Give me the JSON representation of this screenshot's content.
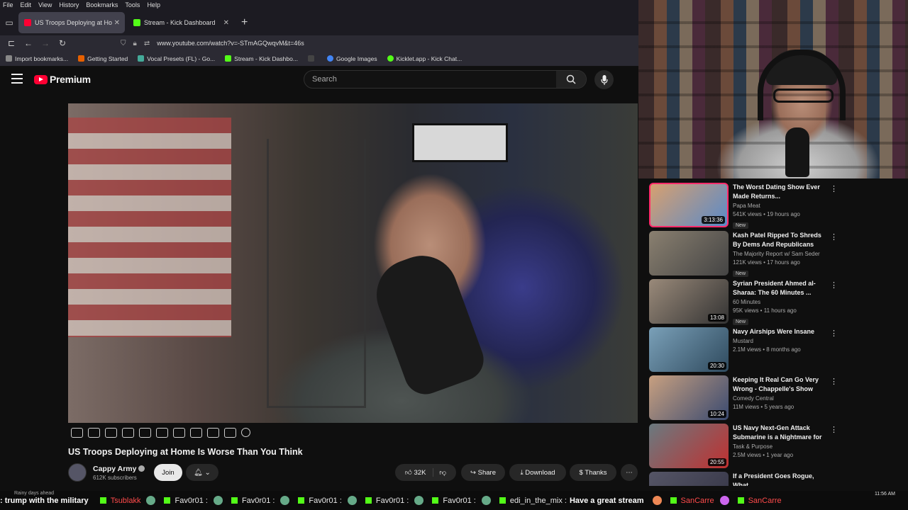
{
  "browser": {
    "menu": [
      "File",
      "Edit",
      "View",
      "History",
      "Bookmarks",
      "Tools",
      "Help"
    ],
    "tabs": [
      {
        "label": "US Troops Deploying at Ho",
        "active": true,
        "fav_color": "#ff0033"
      },
      {
        "label": "Stream - Kick Dashboard",
        "active": false,
        "fav_color": "#53fc18"
      }
    ],
    "url": "www.youtube.com/watch?v=-STmAGQwqvM&t=46s",
    "bookmarks": [
      {
        "label": "Import bookmarks...",
        "color": "#888"
      },
      {
        "label": "Getting Started",
        "color": "#e66000"
      },
      {
        "label": "Vocal Presets (FL) - Go...",
        "color": "#4a9"
      },
      {
        "label": "Stream - Kick Dashbo...",
        "color": "#53fc18"
      },
      {
        "label": "",
        "color": "#444"
      },
      {
        "label": "Google Images",
        "color": "#4285f4"
      },
      {
        "label": "Kicklet.app - Kick Chat...",
        "color": "#53fc18"
      }
    ]
  },
  "youtube": {
    "logo_text": "Premium",
    "search_placeholder": "Search"
  },
  "video": {
    "title": "US Troops Deploying at Home Is Worse Than You Think",
    "channel": "Cappy Army",
    "subscribers": "612K subscribers",
    "join_label": "Join",
    "likes": "32K",
    "share_label": "Share",
    "download_label": "Download",
    "thanks_label": "Thanks"
  },
  "recommendations": [
    {
      "title": "The Worst Dating Show Ever Made Returns...",
      "channel": "Papa Meat",
      "meta": "541K views • 19 hours ago",
      "duration": "3:13:36",
      "new": "New",
      "colors": [
        "#d7a070",
        "#5a8ac8"
      ]
    },
    {
      "title": "Kash Patel Ripped To Shreds By Dems And Republicans",
      "channel": "The Majority Report w/ Sam Seder",
      "meta": "121K views • 17 hours ago",
      "duration": "",
      "new": "New",
      "colors": [
        "#8a8070",
        "#444"
      ]
    },
    {
      "title": "Syrian President Ahmed al-Sharaa: The 60 Minutes ...",
      "channel": "60 Minutes",
      "meta": "95K views • 11 hours ago",
      "duration": "13:08",
      "new": "New",
      "colors": [
        "#9a8a7a",
        "#333"
      ]
    },
    {
      "title": "Navy Airships Were Insane",
      "channel": "Mustard",
      "meta": "2.1M views • 8 months ago",
      "duration": "20:30",
      "new": "",
      "colors": [
        "#7aa0b8",
        "#2f4a5e"
      ]
    },
    {
      "title": "Keeping It Real Can Go Very Wrong - Chappelle's Show",
      "channel": "Comedy Central",
      "meta": "11M views • 5 years ago",
      "duration": "10:24",
      "new": "",
      "colors": [
        "#c8a080",
        "#3a4a70"
      ]
    },
    {
      "title": "US Navy Next-Gen Attack Submarine is a Nightmare for ...",
      "channel": "Task & Purpose",
      "meta": "2.5M views • 1 year ago",
      "duration": "20:55",
      "new": "",
      "colors": [
        "#6a7a80",
        "#c03030"
      ]
    },
    {
      "title": "If a President Goes Rogue, What",
      "channel": "",
      "meta": "",
      "duration": "",
      "new": "",
      "colors": [
        "#556",
        "#334"
      ]
    }
  ],
  "chat": {
    "first_text": ": trump with the military",
    "user1": "Tsublakk",
    "user2": "Fav0r01 :",
    "user3": "Fav0r01 :",
    "user4": "Fav0r01 :",
    "user5": "Fav0r01 :",
    "user6": "Fav0r01 :",
    "user7": "edi_in_the_mix :",
    "msg7": "Have a great stream",
    "user8": "SanCarre",
    "user9": "SanCarre"
  },
  "taskbar": {
    "weather": "Rainy days ahead",
    "time": "11:56 AM"
  }
}
